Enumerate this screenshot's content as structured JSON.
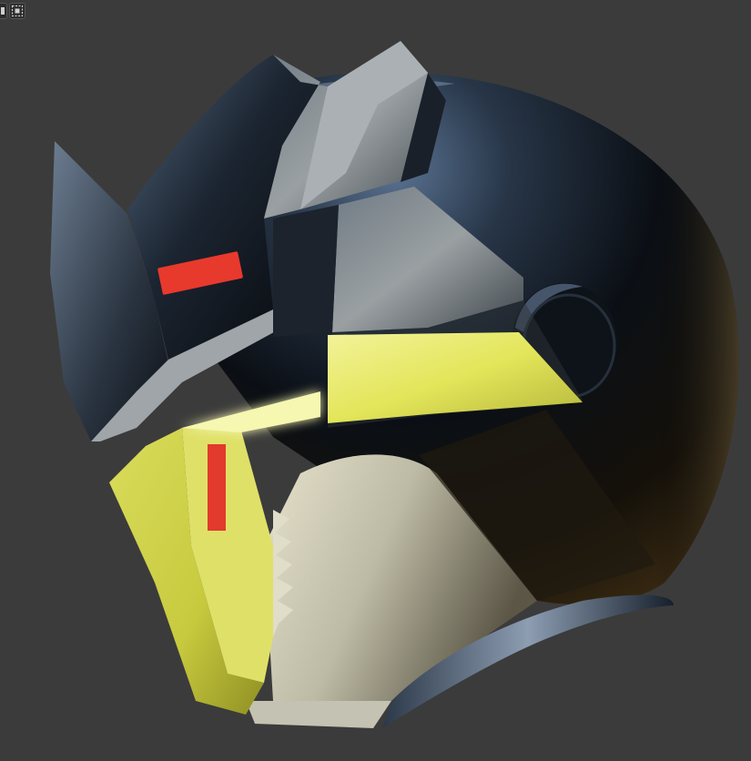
{
  "viewport": {
    "background": "#3b3b3b",
    "tools": [
      {
        "name": "select-box-icon"
      },
      {
        "name": "select-mode-icon"
      }
    ]
  },
  "model": {
    "object": "robot-helmet",
    "colors": {
      "shell_dark": "#0c1016",
      "shell_highlight": "#4f6684",
      "plate_grey": "#8d949a",
      "visor_yellow": "#e3e65a",
      "glow_yellow": "#f4f59a",
      "accent_red": "#e23a2c",
      "jaw_light": "#c9c6b4"
    }
  }
}
